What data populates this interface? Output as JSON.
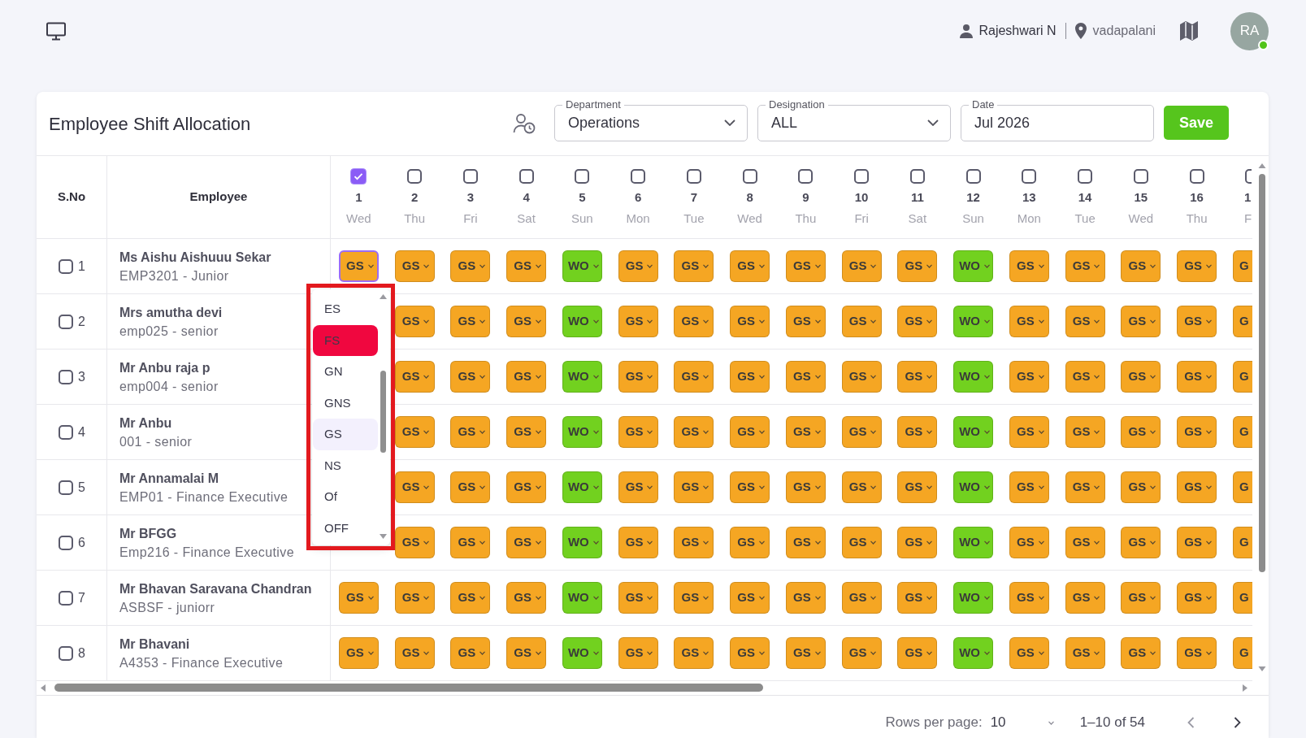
{
  "topbar": {
    "user": "Rajeshwari N",
    "location": "vadapalani",
    "avatar": "RA",
    "online": true
  },
  "header": {
    "title": "Employee Shift Allocation",
    "filters": [
      {
        "kind": "select",
        "label": "Department",
        "value": "Operations"
      },
      {
        "kind": "select",
        "label": "Designation",
        "value": "ALL"
      },
      {
        "kind": "date",
        "label": "Date",
        "value": "Jul 2026"
      }
    ],
    "save_button": "Save"
  },
  "table": {
    "columns": [
      "S.No",
      "Employee"
    ],
    "days": [
      {
        "number": "1",
        "weekday": "Wed",
        "checked": true,
        "kind": "full"
      },
      {
        "number": "2",
        "weekday": "Thu",
        "checked": false,
        "kind": "full"
      },
      {
        "number": "3",
        "weekday": "Fri",
        "checked": false,
        "kind": "full"
      },
      {
        "number": "4",
        "weekday": "Sat",
        "checked": false,
        "kind": "full"
      },
      {
        "number": "5",
        "weekday": "Sun",
        "checked": false,
        "kind": "full"
      },
      {
        "number": "6",
        "weekday": "Mon",
        "checked": false,
        "kind": "full"
      },
      {
        "number": "7",
        "weekday": "Tue",
        "checked": false,
        "kind": "full"
      },
      {
        "number": "8",
        "weekday": "Wed",
        "checked": false,
        "kind": "full"
      },
      {
        "number": "9",
        "weekday": "Thu",
        "checked": false,
        "kind": "full"
      },
      {
        "number": "10",
        "weekday": "Fri",
        "checked": false,
        "kind": "full"
      },
      {
        "number": "11",
        "weekday": "Sat",
        "checked": false,
        "kind": "full"
      },
      {
        "number": "12",
        "weekday": "Sun",
        "checked": false,
        "kind": "full"
      },
      {
        "number": "13",
        "weekday": "Mon",
        "checked": false,
        "kind": "full"
      },
      {
        "number": "14",
        "weekday": "Tue",
        "checked": false,
        "kind": "full"
      },
      {
        "number": "15",
        "weekday": "Wed",
        "checked": false,
        "kind": "full"
      },
      {
        "number": "16",
        "weekday": "Thu",
        "checked": false,
        "kind": "full"
      },
      {
        "number": "1",
        "weekday": "F",
        "checked": false,
        "kind": "clipped"
      }
    ],
    "rows": [
      {
        "sno": "1",
        "checked": false,
        "name": "Ms Aishu Aishuuu Sekar",
        "detail": "EMP3201 - Junior",
        "shifts": [
          {
            "code": "GS",
            "color": "#f5a623",
            "open": true
          },
          {
            "code": "GS",
            "color": "#f5a623",
            "open": false
          },
          {
            "code": "GS",
            "color": "#f5a623",
            "open": false
          },
          {
            "code": "GS",
            "color": "#f5a623",
            "open": false
          },
          {
            "code": "WO",
            "color": "#72d11f",
            "open": false
          },
          {
            "code": "GS",
            "color": "#f5a623",
            "open": false
          },
          {
            "code": "GS",
            "color": "#f5a623",
            "open": false
          },
          {
            "code": "GS",
            "color": "#f5a623",
            "open": false
          },
          {
            "code": "GS",
            "color": "#f5a623",
            "open": false
          },
          {
            "code": "GS",
            "color": "#f5a623",
            "open": false
          },
          {
            "code": "GS",
            "color": "#f5a623",
            "open": false
          },
          {
            "code": "WO",
            "color": "#72d11f",
            "open": false
          },
          {
            "code": "GS",
            "color": "#f5a623",
            "open": false
          },
          {
            "code": "GS",
            "color": "#f5a623",
            "open": false
          },
          {
            "code": "GS",
            "color": "#f5a623",
            "open": false
          },
          {
            "code": "GS",
            "color": "#f5a623",
            "open": false
          },
          {
            "code": "G",
            "color": "#f5a623",
            "open": false
          }
        ]
      },
      {
        "sno": "2",
        "checked": false,
        "name": "Mrs amutha devi",
        "detail": "emp025 - senior",
        "shifts": [
          {
            "code": "GS",
            "color": "#f5a623",
            "open": false
          },
          {
            "code": "GS",
            "color": "#f5a623",
            "open": false
          },
          {
            "code": "GS",
            "color": "#f5a623",
            "open": false
          },
          {
            "code": "WO",
            "color": "#72d11f",
            "open": false
          },
          {
            "code": "GS",
            "color": "#f5a623",
            "open": false
          },
          {
            "code": "GS",
            "color": "#f5a623",
            "open": false
          },
          {
            "code": "GS",
            "color": "#f5a623",
            "open": false
          },
          {
            "code": "GS",
            "color": "#f5a623",
            "open": false
          },
          {
            "code": "GS",
            "color": "#f5a623",
            "open": false
          },
          {
            "code": "GS",
            "color": "#f5a623",
            "open": false
          },
          {
            "code": "WO",
            "color": "#72d11f",
            "open": false
          },
          {
            "code": "GS",
            "color": "#f5a623",
            "open": false
          },
          {
            "code": "GS",
            "color": "#f5a623",
            "open": false
          },
          {
            "code": "GS",
            "color": "#f5a623",
            "open": false
          },
          {
            "code": "GS",
            "color": "#f5a623",
            "open": false
          },
          {
            "code": "G",
            "color": "#f5a623",
            "open": false
          }
        ]
      },
      {
        "sno": "3",
        "checked": false,
        "name": "Mr Anbu raja p",
        "detail": "emp004 - senior",
        "shifts": [
          {
            "code": "GS",
            "color": "#f5a623",
            "open": false
          },
          {
            "code": "GS",
            "color": "#f5a623",
            "open": false
          },
          {
            "code": "GS",
            "color": "#f5a623",
            "open": false
          },
          {
            "code": "WO",
            "color": "#72d11f",
            "open": false
          },
          {
            "code": "GS",
            "color": "#f5a623",
            "open": false
          },
          {
            "code": "GS",
            "color": "#f5a623",
            "open": false
          },
          {
            "code": "GS",
            "color": "#f5a623",
            "open": false
          },
          {
            "code": "GS",
            "color": "#f5a623",
            "open": false
          },
          {
            "code": "GS",
            "color": "#f5a623",
            "open": false
          },
          {
            "code": "GS",
            "color": "#f5a623",
            "open": false
          },
          {
            "code": "WO",
            "color": "#72d11f",
            "open": false
          },
          {
            "code": "GS",
            "color": "#f5a623",
            "open": false
          },
          {
            "code": "GS",
            "color": "#f5a623",
            "open": false
          },
          {
            "code": "GS",
            "color": "#f5a623",
            "open": false
          },
          {
            "code": "GS",
            "color": "#f5a623",
            "open": false
          },
          {
            "code": "G",
            "color": "#f5a623",
            "open": false
          }
        ]
      },
      {
        "sno": "4",
        "checked": false,
        "name": "Mr Anbu",
        "detail": "001 - senior",
        "shifts": [
          {
            "code": "GS",
            "color": "#f5a623",
            "open": false
          },
          {
            "code": "GS",
            "color": "#f5a623",
            "open": false
          },
          {
            "code": "GS",
            "color": "#f5a623",
            "open": false
          },
          {
            "code": "WO",
            "color": "#72d11f",
            "open": false
          },
          {
            "code": "GS",
            "color": "#f5a623",
            "open": false
          },
          {
            "code": "GS",
            "color": "#f5a623",
            "open": false
          },
          {
            "code": "GS",
            "color": "#f5a623",
            "open": false
          },
          {
            "code": "GS",
            "color": "#f5a623",
            "open": false
          },
          {
            "code": "GS",
            "color": "#f5a623",
            "open": false
          },
          {
            "code": "GS",
            "color": "#f5a623",
            "open": false
          },
          {
            "code": "WO",
            "color": "#72d11f",
            "open": false
          },
          {
            "code": "GS",
            "color": "#f5a623",
            "open": false
          },
          {
            "code": "GS",
            "color": "#f5a623",
            "open": false
          },
          {
            "code": "GS",
            "color": "#f5a623",
            "open": false
          },
          {
            "code": "GS",
            "color": "#f5a623",
            "open": false
          },
          {
            "code": "G",
            "color": "#f5a623",
            "open": false
          }
        ]
      },
      {
        "sno": "5",
        "checked": false,
        "name": "Mr Annamalai M",
        "detail": "EMP01 - Finance Executive",
        "shifts": [
          {
            "code": "GS",
            "color": "#f5a623",
            "open": false
          },
          {
            "code": "GS",
            "color": "#f5a623",
            "open": false
          },
          {
            "code": "GS",
            "color": "#f5a623",
            "open": false
          },
          {
            "code": "WO",
            "color": "#72d11f",
            "open": false
          },
          {
            "code": "GS",
            "color": "#f5a623",
            "open": false
          },
          {
            "code": "GS",
            "color": "#f5a623",
            "open": false
          },
          {
            "code": "GS",
            "color": "#f5a623",
            "open": false
          },
          {
            "code": "GS",
            "color": "#f5a623",
            "open": false
          },
          {
            "code": "GS",
            "color": "#f5a623",
            "open": false
          },
          {
            "code": "GS",
            "color": "#f5a623",
            "open": false
          },
          {
            "code": "WO",
            "color": "#72d11f",
            "open": false
          },
          {
            "code": "GS",
            "color": "#f5a623",
            "open": false
          },
          {
            "code": "GS",
            "color": "#f5a623",
            "open": false
          },
          {
            "code": "GS",
            "color": "#f5a623",
            "open": false
          },
          {
            "code": "GS",
            "color": "#f5a623",
            "open": false
          },
          {
            "code": "G",
            "color": "#f5a623",
            "open": false
          }
        ]
      },
      {
        "sno": "6",
        "checked": false,
        "name": "Mr BFGG",
        "detail": "Emp216 - Finance Executive",
        "shifts": [
          {
            "code": "GS",
            "color": "#f5a623",
            "open": false
          },
          {
            "code": "GS",
            "color": "#f5a623",
            "open": false
          },
          {
            "code": "GS",
            "color": "#f5a623",
            "open": false
          },
          {
            "code": "WO",
            "color": "#72d11f",
            "open": false
          },
          {
            "code": "GS",
            "color": "#f5a623",
            "open": false
          },
          {
            "code": "GS",
            "color": "#f5a623",
            "open": false
          },
          {
            "code": "GS",
            "color": "#f5a623",
            "open": false
          },
          {
            "code": "GS",
            "color": "#f5a623",
            "open": false
          },
          {
            "code": "GS",
            "color": "#f5a623",
            "open": false
          },
          {
            "code": "GS",
            "color": "#f5a623",
            "open": false
          },
          {
            "code": "WO",
            "color": "#72d11f",
            "open": false
          },
          {
            "code": "GS",
            "color": "#f5a623",
            "open": false
          },
          {
            "code": "GS",
            "color": "#f5a623",
            "open": false
          },
          {
            "code": "GS",
            "color": "#f5a623",
            "open": false
          },
          {
            "code": "GS",
            "color": "#f5a623",
            "open": false
          },
          {
            "code": "G",
            "color": "#f5a623",
            "open": false
          }
        ]
      },
      {
        "sno": "7",
        "checked": false,
        "name": "Mr Bhavan Saravana Chandran",
        "detail": "ASBSF - juniorr",
        "shifts": [
          {
            "code": "GS",
            "color": "#f5a623",
            "open": false
          },
          {
            "code": "GS",
            "color": "#f5a623",
            "open": false
          },
          {
            "code": "GS",
            "color": "#f5a623",
            "open": false
          },
          {
            "code": "GS",
            "color": "#f5a623",
            "open": false
          },
          {
            "code": "WO",
            "color": "#72d11f",
            "open": false
          },
          {
            "code": "GS",
            "color": "#f5a623",
            "open": false
          },
          {
            "code": "GS",
            "color": "#f5a623",
            "open": false
          },
          {
            "code": "GS",
            "color": "#f5a623",
            "open": false
          },
          {
            "code": "GS",
            "color": "#f5a623",
            "open": false
          },
          {
            "code": "GS",
            "color": "#f5a623",
            "open": false
          },
          {
            "code": "GS",
            "color": "#f5a623",
            "open": false
          },
          {
            "code": "WO",
            "color": "#72d11f",
            "open": false
          },
          {
            "code": "GS",
            "color": "#f5a623",
            "open": false
          },
          {
            "code": "GS",
            "color": "#f5a623",
            "open": false
          },
          {
            "code": "GS",
            "color": "#f5a623",
            "open": false
          },
          {
            "code": "GS",
            "color": "#f5a623",
            "open": false
          },
          {
            "code": "G",
            "color": "#f5a623",
            "open": false
          }
        ]
      },
      {
        "sno": "8",
        "checked": false,
        "name": "Mr Bhavani",
        "detail": "A4353 - Finance Executive",
        "shifts": [
          {
            "code": "GS",
            "color": "#f5a623",
            "open": false
          },
          {
            "code": "GS",
            "color": "#f5a623",
            "open": false
          },
          {
            "code": "GS",
            "color": "#f5a623",
            "open": false
          },
          {
            "code": "GS",
            "color": "#f5a623",
            "open": false
          },
          {
            "code": "WO",
            "color": "#72d11f",
            "open": false
          },
          {
            "code": "GS",
            "color": "#f5a623",
            "open": false
          },
          {
            "code": "GS",
            "color": "#f5a623",
            "open": false
          },
          {
            "code": "GS",
            "color": "#f5a623",
            "open": false
          },
          {
            "code": "GS",
            "color": "#f5a623",
            "open": false
          },
          {
            "code": "GS",
            "color": "#f5a623",
            "open": false
          },
          {
            "code": "GS",
            "color": "#f5a623",
            "open": false
          },
          {
            "code": "WO",
            "color": "#72d11f",
            "open": false
          },
          {
            "code": "GS",
            "color": "#f5a623",
            "open": false
          },
          {
            "code": "GS",
            "color": "#f5a623",
            "open": false
          },
          {
            "code": "GS",
            "color": "#f5a623",
            "open": false
          },
          {
            "code": "GS",
            "color": "#f5a623",
            "open": false
          },
          {
            "code": "G",
            "color": "#f5a623",
            "open": false
          }
        ]
      }
    ]
  },
  "shift_menu": {
    "options": [
      {
        "label": "ES",
        "highlighted": false,
        "selected": false
      },
      {
        "label": "FS",
        "highlighted": true,
        "selected": false
      },
      {
        "label": "GN",
        "highlighted": false,
        "selected": false
      },
      {
        "label": "GNS",
        "highlighted": false,
        "selected": false
      },
      {
        "label": "GS",
        "highlighted": false,
        "selected": true
      },
      {
        "label": "NS",
        "highlighted": false,
        "selected": false
      },
      {
        "label": "Of",
        "highlighted": false,
        "selected": false
      },
      {
        "label": "OFF",
        "highlighted": false,
        "selected": false
      }
    ]
  },
  "pagination": {
    "rows_per_page_label": "Rows per page:",
    "rows_per_page": "10",
    "range": "1–10 of 54",
    "previous": {
      "disabled": true
    },
    "next": {
      "disabled": false
    }
  }
}
